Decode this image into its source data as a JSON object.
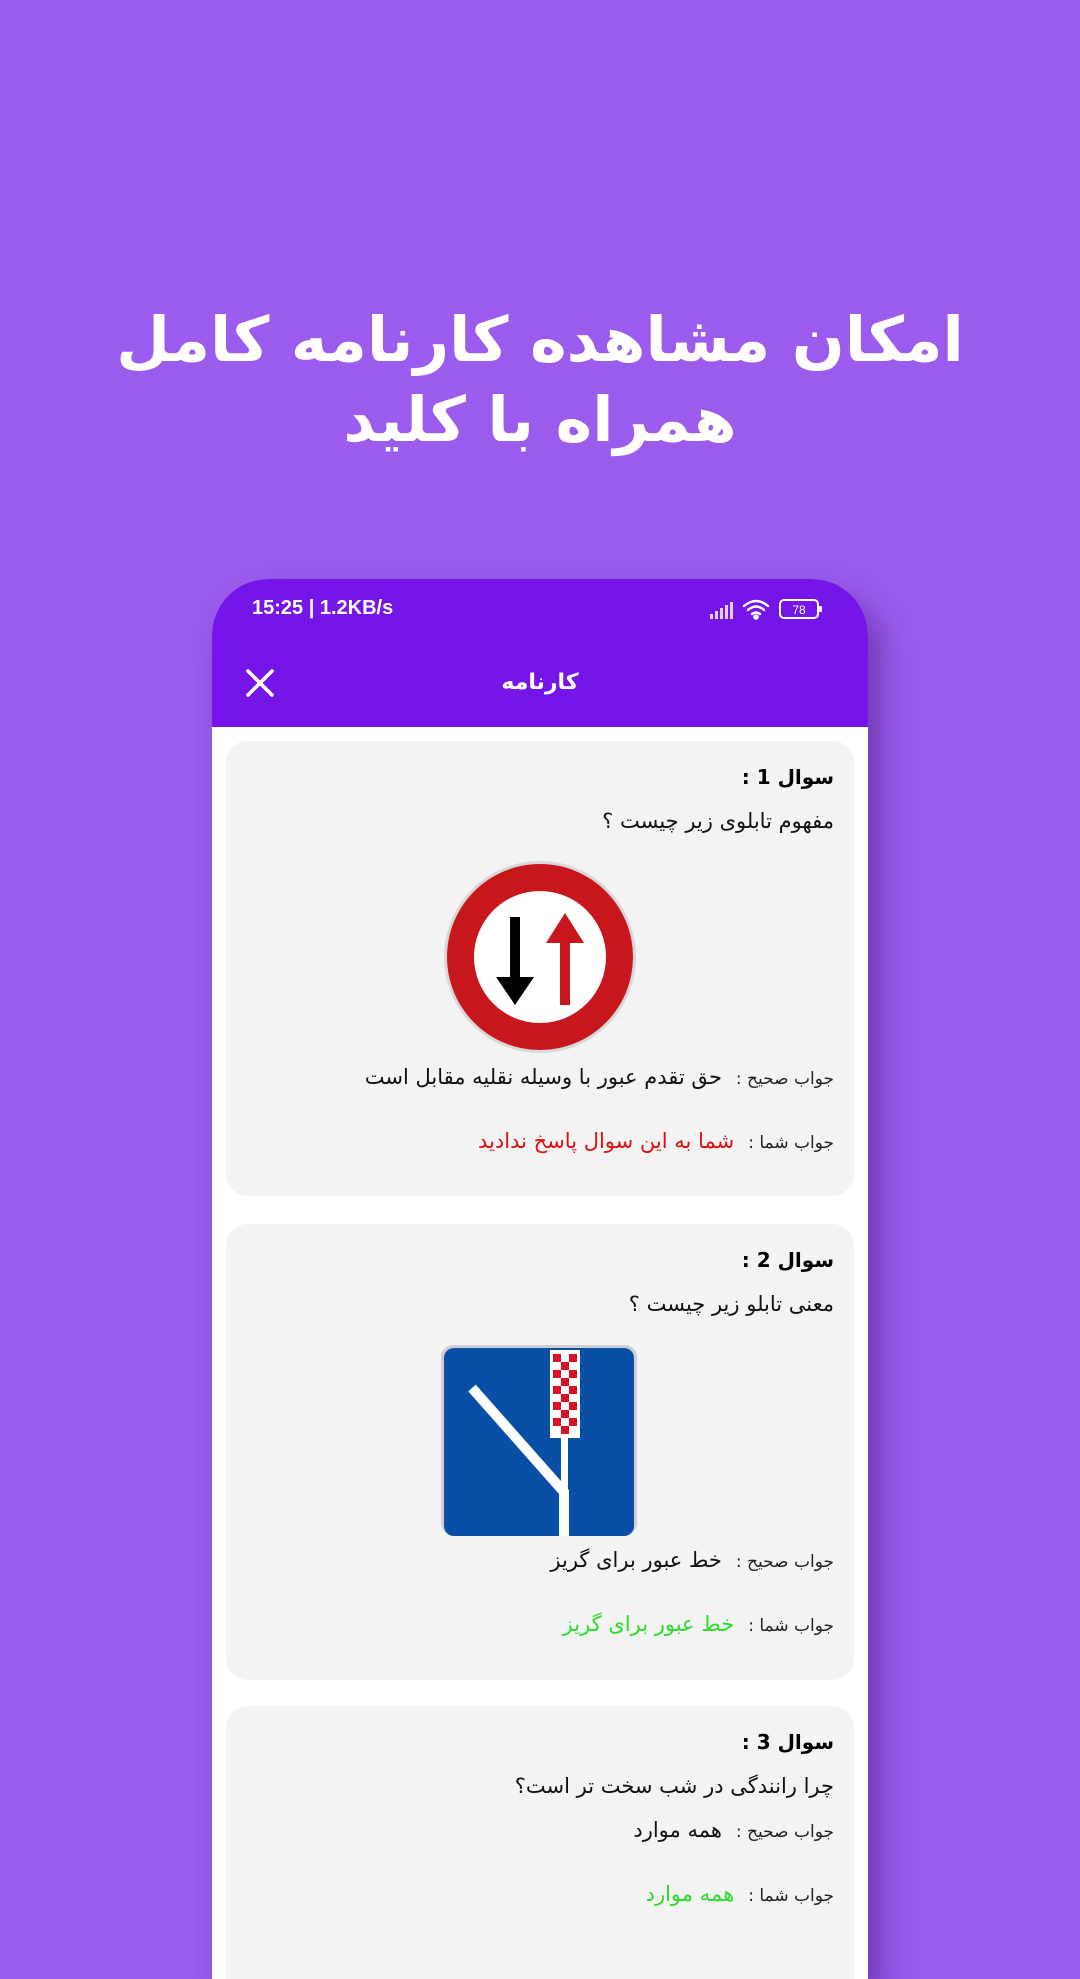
{
  "headline": {
    "line1": "امکان مشاهده کارنامه کامل",
    "line2": "همراه با کلید"
  },
  "status_bar": {
    "time": "15:25 | 1.2KB/s",
    "battery": "78",
    "icons": [
      "signal-icon",
      "wifi-icon",
      "battery-icon"
    ]
  },
  "app_bar": {
    "title": "کارنامه",
    "close_icon": "close-icon"
  },
  "questions": [
    {
      "title": "سوال 1 :",
      "text": "مفهوم تابلوی زیر چیست ؟",
      "image": "priority-to-oncoming-traffic-sign",
      "correct_label": "جواب صحیح :",
      "correct_answer": "حق تقدم عبور با وسیله نقلیه مقابل است",
      "your_label": "جواب شما :",
      "your_answer": "شما به این سوال پاسخ ندادید",
      "your_answer_status": "unanswered"
    },
    {
      "title": "سوال 2 :",
      "text": "معنی تابلو زیر چیست ؟",
      "image": "escape-lane-sign",
      "correct_label": "جواب صحیح :",
      "correct_answer": "خط عبور برای گریز",
      "your_label": "جواب شما :",
      "your_answer": "خط عبور برای گریز",
      "your_answer_status": "correct"
    },
    {
      "title": "سوال 3 :",
      "text": "چرا رانندگی در شب سخت تر است؟",
      "correct_label": "جواب صحیح :",
      "correct_answer": "همه موارد",
      "your_label": "جواب شما :",
      "your_answer": "همه موارد",
      "your_answer_status": "correct"
    }
  ],
  "colors": {
    "background": "#9b5bed",
    "app_bar": "#7515e8",
    "card": "#f3f3f3",
    "unanswered": "#e01010",
    "correct": "#2bdc2b"
  }
}
